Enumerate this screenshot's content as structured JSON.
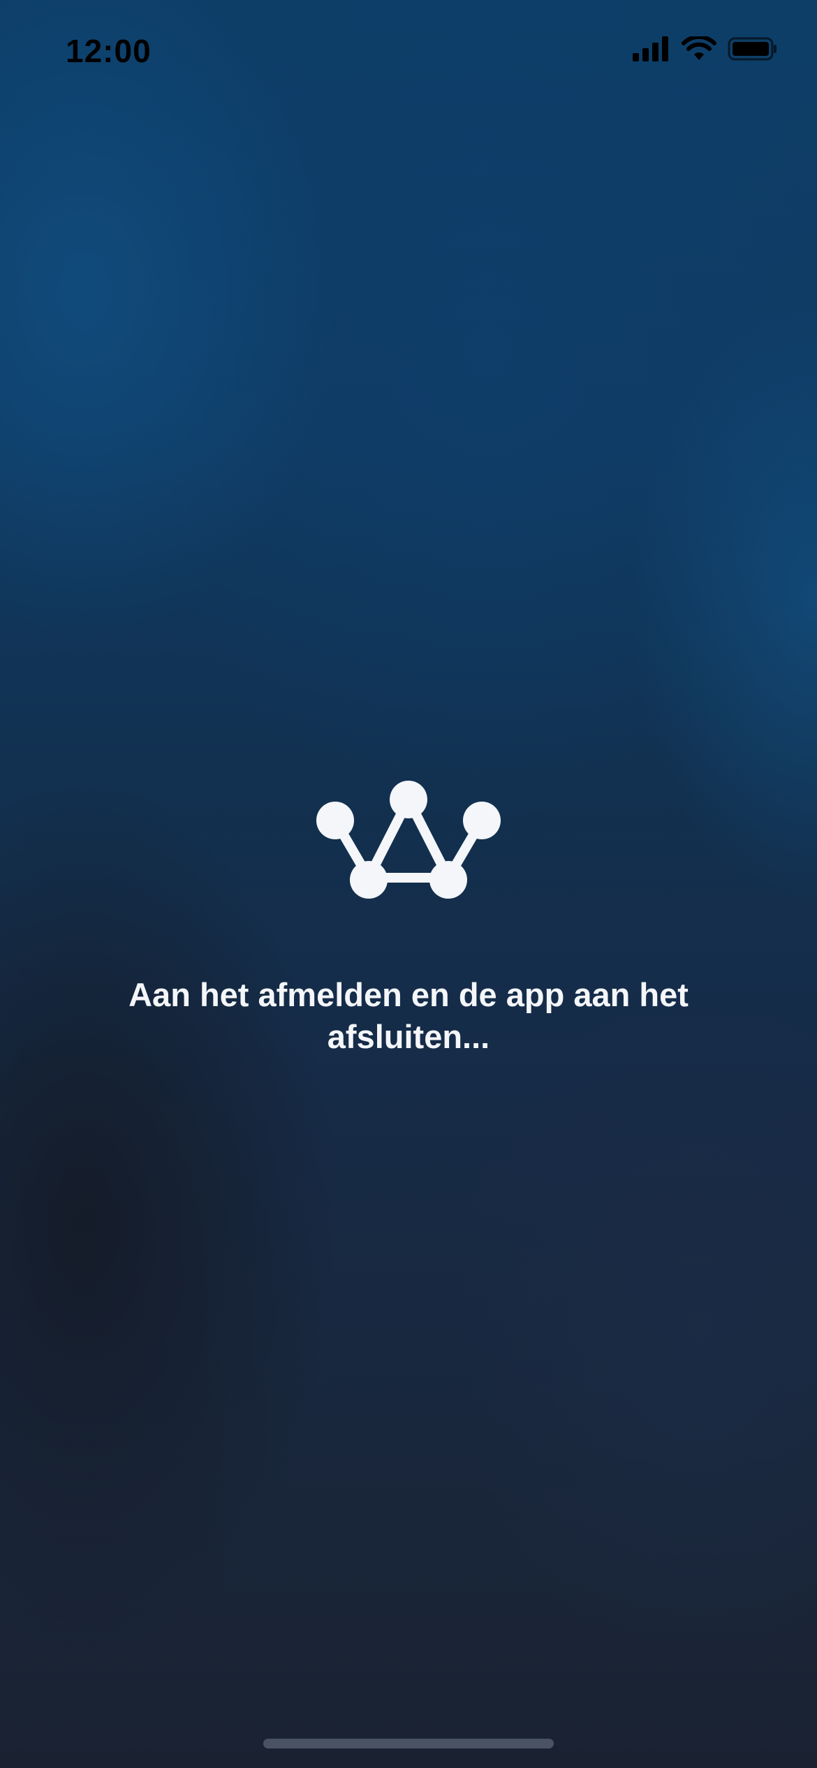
{
  "status_bar": {
    "time": "12:00",
    "icons": [
      "cellular-signal-icon",
      "wifi-icon",
      "battery-icon"
    ]
  },
  "logo": {
    "icon": "crown-network-logo-icon"
  },
  "message": {
    "text": "Aan het afmelden en de app aan het afsluiten..."
  },
  "colors": {
    "background_top": "#0d3e68",
    "background_bottom": "#1a2232",
    "text": "#f4f6f9",
    "status_bar_text": "#000000",
    "home_indicator": "#4a5364"
  }
}
